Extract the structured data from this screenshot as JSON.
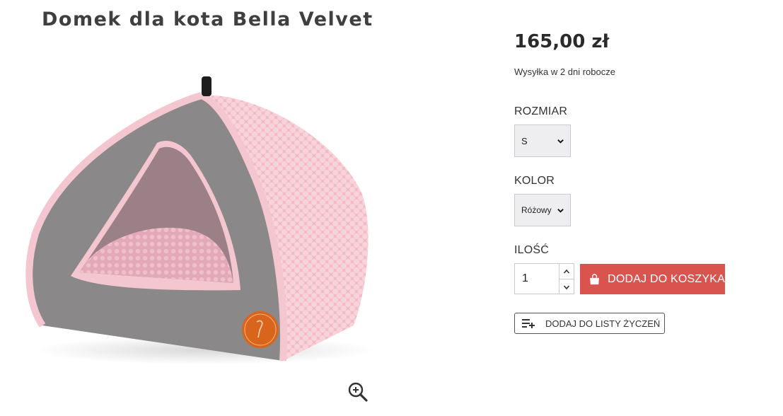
{
  "product": {
    "title": "Domek dla kota Bella Velvet",
    "price": "165,00 zł",
    "shipping": "Wysyłka w 2 dni robocze"
  },
  "options": {
    "size_label": "ROZMIAR",
    "size_value": "S",
    "color_label": "KOLOR",
    "color_value": "Różowy",
    "qty_label": "ILOŚĆ",
    "qty_value": "1"
  },
  "actions": {
    "add_to_cart": "DODAJ DO KOSZYKA",
    "add_to_wishlist": "DODAJ DO LISTY ŻYCZEŃ"
  },
  "icons": {
    "zoom": "zoom-in-icon",
    "cart": "shopping-bag-icon",
    "wishlist": "playlist-add-icon",
    "chevron": "chevron-down-icon"
  },
  "colors": {
    "accent": "#d9534f",
    "bed_grey": "#8a8888",
    "bed_pink": "#f4c6cf",
    "badge": "#d9651d"
  }
}
